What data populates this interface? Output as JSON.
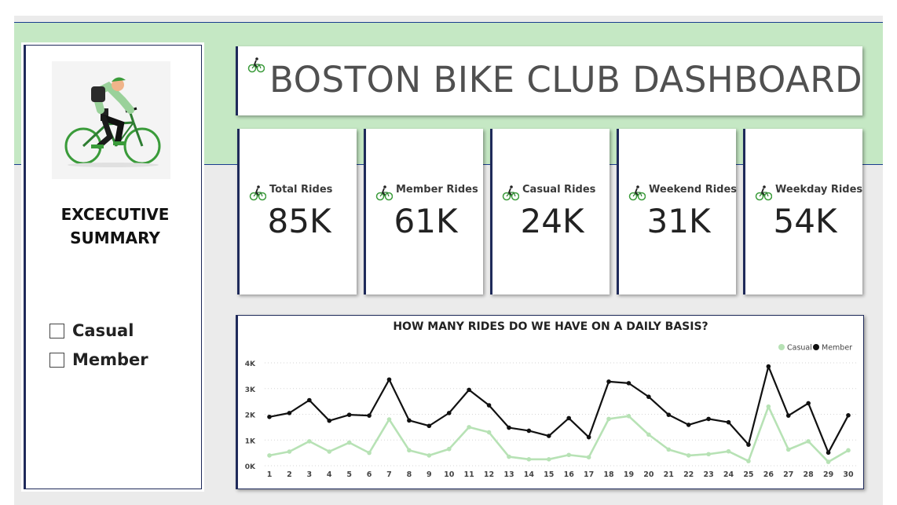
{
  "header": {
    "title": "BOSTON BIKE CLUB DASHBOARD"
  },
  "sidebar": {
    "title_line1": "EXCECUTIVE",
    "title_line2": "SUMMARY",
    "slicer": [
      {
        "label": "Casual",
        "checked": false
      },
      {
        "label": "Member",
        "checked": false
      }
    ]
  },
  "kpis": [
    {
      "label": "Total Rides",
      "value": "85K"
    },
    {
      "label": "Member Rides",
      "value": "61K"
    },
    {
      "label": "Casual Rides",
      "value": "24K"
    },
    {
      "label": "Weekend Rides",
      "value": "31K"
    },
    {
      "label": "Weekday Rides",
      "value": "54K"
    }
  ],
  "colors": {
    "band": "#c5e8c4",
    "casual": "#b7e2b5",
    "member": "#111111",
    "card_border": "#1f2a5a"
  },
  "icons": [
    "cyclist-icon",
    "checkbox-icon"
  ],
  "chart_data": {
    "type": "line",
    "title": "HOW MANY RIDES DO WE HAVE ON A DAILY BASIS?",
    "xlabel": "",
    "ylabel": "",
    "x": [
      1,
      2,
      3,
      4,
      5,
      6,
      7,
      8,
      9,
      10,
      11,
      12,
      13,
      14,
      15,
      16,
      17,
      18,
      19,
      20,
      21,
      22,
      23,
      24,
      25,
      26,
      27,
      28,
      29,
      30
    ],
    "yticks": [
      "0K",
      "1K",
      "2K",
      "3K",
      "4K"
    ],
    "ylim": [
      0,
      4000
    ],
    "grid": true,
    "legend_position": "top-right",
    "series": [
      {
        "name": "Casual",
        "color": "#b7e2b5",
        "values": [
          400,
          550,
          950,
          550,
          900,
          500,
          1800,
          600,
          400,
          650,
          1500,
          1300,
          350,
          250,
          250,
          420,
          330,
          1820,
          1930,
          1210,
          630,
          400,
          450,
          560,
          180,
          2300,
          630,
          950,
          150,
          600
        ]
      },
      {
        "name": "Member",
        "color": "#111111",
        "values": [
          1900,
          2050,
          2550,
          1750,
          1980,
          1950,
          3350,
          1760,
          1550,
          2050,
          2950,
          2350,
          1480,
          1360,
          1160,
          1850,
          1110,
          3270,
          3210,
          2680,
          1980,
          1590,
          1820,
          1690,
          820,
          3860,
          1950,
          2430,
          510,
          1960
        ]
      }
    ]
  }
}
